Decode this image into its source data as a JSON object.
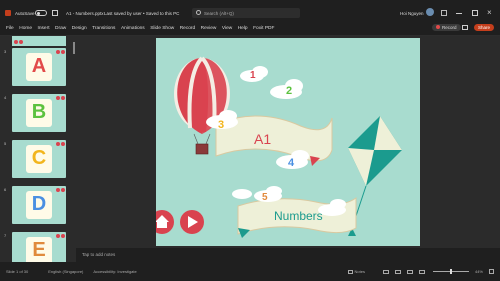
{
  "window": {
    "autosave_label": "AutoSave",
    "autosave_state": "Off",
    "filename": "A1 - Numbers.pptx",
    "save_status": "Last saved by user • Saved to this PC",
    "search_placeholder": "Search (Alt+Q)",
    "user_name": "Hoi Nguyen"
  },
  "ribbon": {
    "tabs": [
      "File",
      "Home",
      "Insert",
      "Draw",
      "Design",
      "Transitions",
      "Animations",
      "Slide Show",
      "Record",
      "Review",
      "View",
      "Help",
      "Foxit PDF"
    ],
    "record_label": "Record",
    "share_label": "Share"
  },
  "thumbs": [
    {
      "num": "3",
      "letter": "A",
      "color": "#e24a4a"
    },
    {
      "num": "4",
      "letter": "B",
      "color": "#5cc23f"
    },
    {
      "num": "5",
      "letter": "C",
      "color": "#f2b51c"
    },
    {
      "num": "6",
      "letter": "D",
      "color": "#4a8fe2"
    },
    {
      "num": "7",
      "letter": "E",
      "color": "#e08a3c"
    }
  ],
  "slide": {
    "title": "A1",
    "subtitle": "Numbers",
    "numbers": [
      "1",
      "2",
      "3",
      "4",
      "5"
    ],
    "colors": {
      "background": "#a8dccf",
      "balloon_red": "#d9434f",
      "kite_teal": "#1b9b8e",
      "banner": "#eef0d8",
      "nav_red": "#d9434f"
    }
  },
  "notes_placeholder": "Tap to add notes",
  "status": {
    "slide_count": "Slide 1 of 30",
    "language": "English (Singapore)",
    "accessibility": "Accessibility: Investigate",
    "notes_label": "Notes",
    "zoom": "44%"
  }
}
